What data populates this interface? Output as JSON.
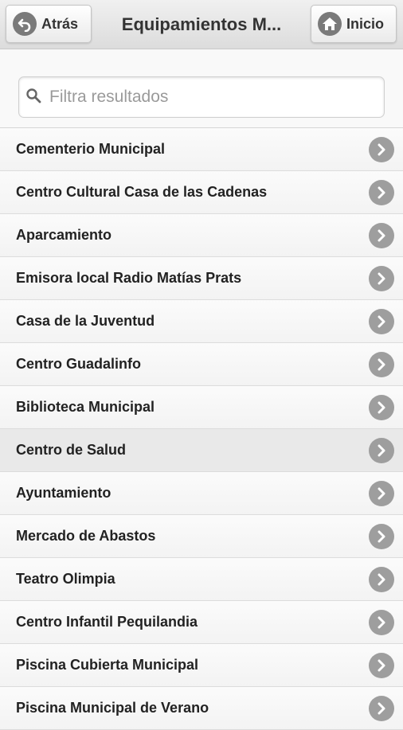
{
  "header": {
    "back_label": "Atrás",
    "title": "Equipamientos M...",
    "home_label": "Inicio"
  },
  "search": {
    "placeholder": "Filtra resultados"
  },
  "list": {
    "items": [
      {
        "label": "Cementerio Municipal"
      },
      {
        "label": "Centro Cultural Casa de las Cadenas"
      },
      {
        "label": "Aparcamiento"
      },
      {
        "label": "Emisora local Radio Matías Prats"
      },
      {
        "label": "Casa de la Juventud"
      },
      {
        "label": "Centro Guadalinfo"
      },
      {
        "label": "Biblioteca Municipal"
      },
      {
        "label": "Centro de Salud"
      },
      {
        "label": "Ayuntamiento"
      },
      {
        "label": "Mercado de Abastos"
      },
      {
        "label": "Teatro Olimpia"
      },
      {
        "label": "Centro Infantil Pequilandia"
      },
      {
        "label": "Piscina Cubierta Municipal"
      },
      {
        "label": "Piscina Municipal de Verano"
      }
    ],
    "icon": "chevron-right-icon"
  },
  "colors": {
    "icon_gray": "#9e9e9e",
    "highlight_row": "#e9e9e9"
  }
}
